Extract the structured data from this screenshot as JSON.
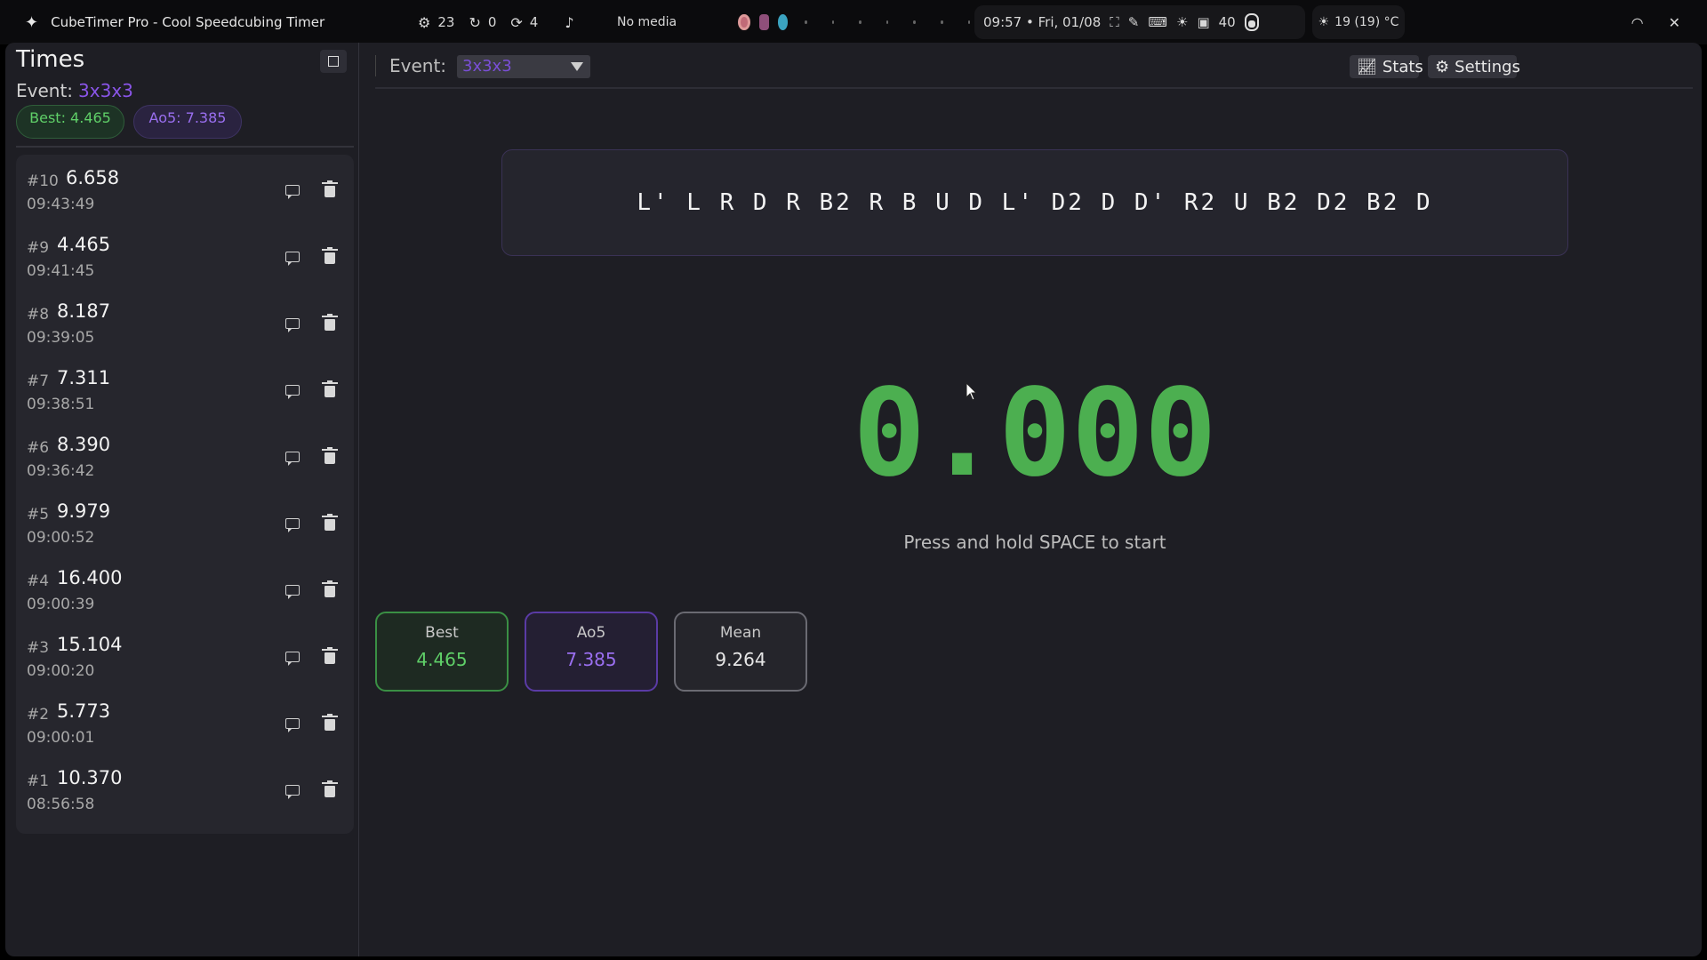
{
  "topbar": {
    "app_title": "CubeTimer Pro - Cool Speedcubing Timer",
    "counters": [
      {
        "icon": "gear-cycle-icon",
        "value": "23"
      },
      {
        "icon": "sync-icon",
        "value": "0"
      },
      {
        "icon": "update-icon",
        "value": "4"
      }
    ],
    "media": "No media",
    "clock": "09:57 • Fri, 01/08",
    "volume": "40",
    "weather": "19 (19) °C"
  },
  "sidebar": {
    "title": "Times",
    "event_label": "Event:",
    "event_value": "3x3x3",
    "best_badge": "Best: 4.465",
    "ao5_badge": "Ao5: 7.385",
    "times": [
      {
        "index": "#10",
        "value": "6.658",
        "time": "09:43:49"
      },
      {
        "index": "#9",
        "value": "4.465",
        "time": "09:41:45"
      },
      {
        "index": "#8",
        "value": "8.187",
        "time": "09:39:05"
      },
      {
        "index": "#7",
        "value": "7.311",
        "time": "09:38:51"
      },
      {
        "index": "#6",
        "value": "8.390",
        "time": "09:36:42"
      },
      {
        "index": "#5",
        "value": "9.979",
        "time": "09:00:52"
      },
      {
        "index": "#4",
        "value": "16.400",
        "time": "09:00:39"
      },
      {
        "index": "#3",
        "value": "15.104",
        "time": "09:00:20"
      },
      {
        "index": "#2",
        "value": "5.773",
        "time": "09:00:01"
      },
      {
        "index": "#1",
        "value": "10.370",
        "time": "08:56:58"
      }
    ]
  },
  "main": {
    "event_label": "Event:",
    "event_selected": "3x3x3",
    "stats_label": "Stats",
    "settings_label": "Settings",
    "scramble": "L' L R D R B2 R B U D L' D2 D D' R2 U B2 D2 B2 D",
    "timer": "0.000",
    "hint": "Press and hold SPACE to start",
    "cards": {
      "best_label": "Best",
      "best_value": "4.465",
      "ao5_label": "Ao5",
      "ao5_value": "7.385",
      "mean_label": "Mean",
      "mean_value": "9.264"
    }
  },
  "colors": {
    "accent_green": "#4caf50",
    "accent_purple": "#8a55e8",
    "background": "#1e1e24"
  }
}
